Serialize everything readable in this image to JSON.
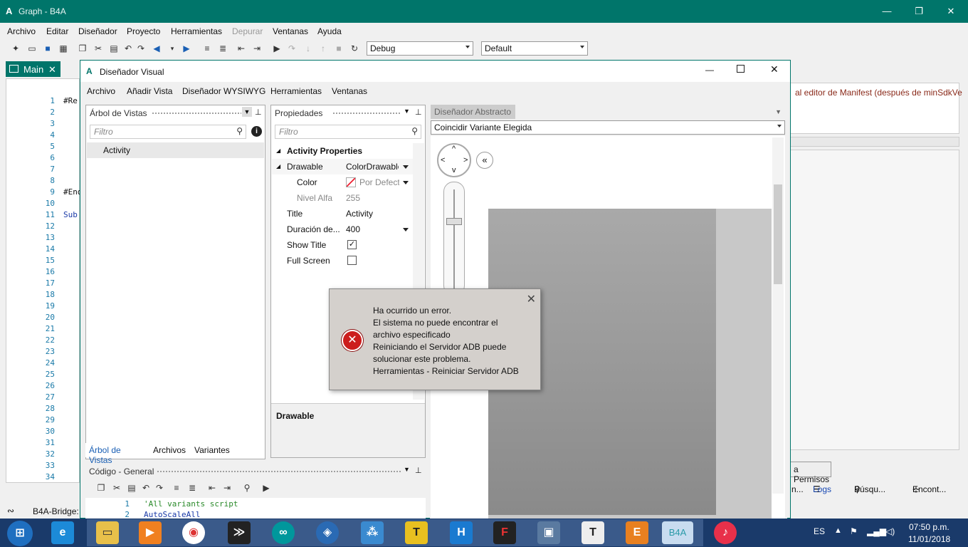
{
  "window": {
    "logo": "A",
    "title": "Graph - B4A",
    "minimize": "—",
    "restore": "❐",
    "close": "✕"
  },
  "menu": [
    "Archivo",
    "Editar",
    "Diseñador",
    "Proyecto",
    "Herramientas",
    "Depurar",
    "Ventanas",
    "Ayuda"
  ],
  "toolbar": {
    "config_combo": "Debug",
    "theme_combo": "Default"
  },
  "doc_tab": {
    "label": "Main",
    "close": "✕"
  },
  "editor": {
    "lines": [
      "1",
      "2",
      "3",
      "4",
      "5",
      "6",
      "7",
      "8",
      "9",
      "10",
      "11",
      "12",
      "13",
      "14",
      "15",
      "16",
      "17",
      "18",
      "19",
      "20",
      "21",
      "22",
      "23",
      "24",
      "25",
      "26",
      "27",
      "28",
      "29",
      "30",
      "31",
      "32",
      "33",
      "34"
    ],
    "code": [
      {
        "line": 1,
        "text": "#Re"
      },
      {
        "line": 9,
        "text": "#End"
      },
      {
        "line": 11,
        "text": "Sub"
      }
    ]
  },
  "right_pane": {
    "manifest_text": "al editor de Manifest (después de minSdkVe",
    "permisos_button": "a Permisos",
    "bottom_tabs": [
      "n...",
      "Logs",
      "Búsqu...",
      "Encont..."
    ]
  },
  "status": {
    "bridge": "B4A-Bridge:"
  },
  "designer": {
    "logo": "A",
    "title": "Diseñador Visual",
    "menu": [
      "Archivo",
      "Añadir Vista",
      "Diseñador WYSIWYG",
      "Herramientas",
      "Ventanas"
    ],
    "tree_panel": {
      "header": "Árbol de Vistas",
      "filter_placeholder": "Filtro",
      "items": [
        "Activity"
      ],
      "tabs": [
        "Árbol de Vistas",
        "Archivos",
        "Variantes"
      ]
    },
    "props_panel": {
      "header": "Propiedades",
      "filter_placeholder": "Filtro",
      "section": "Activity Properties",
      "rows": [
        {
          "name": "Drawable",
          "value": "ColorDrawable"
        },
        {
          "name": "Color",
          "value": "Por Defecto"
        },
        {
          "name": "Nivel Alfa",
          "value": "255"
        },
        {
          "name": "Title",
          "value": "Activity"
        },
        {
          "name": "Duración de...",
          "value": "400"
        },
        {
          "name": "Show Title",
          "value": "✓"
        },
        {
          "name": "Full Screen",
          "value": ""
        }
      ],
      "description": "Drawable"
    },
    "abstract": {
      "tab": "Diseñador Abstracto",
      "variant": "Coincidir Variante Elegida"
    },
    "code_panel": {
      "header": "Código - General",
      "lines": [
        {
          "num": "1",
          "text": "'All variants script"
        },
        {
          "num": "2",
          "text": "AutoScaleAll"
        }
      ]
    }
  },
  "error_dialog": {
    "lines": [
      "Ha ocurrido un error.",
      "El sistema no puede encontrar el",
      "archivo especificado",
      "Reiniciando el Servidor ADB puede",
      "solucionar este problema.",
      "Herramientas - Reiniciar Servidor ADB"
    ],
    "close": "✕"
  },
  "taskbar": {
    "apps": [
      "b4a-icon",
      "music-icon"
    ],
    "b4a_label": "B4A",
    "lang": "ES",
    "time": "07:50 p.m.",
    "date": "11/01/2018"
  },
  "colors": {
    "accent": "#00756a",
    "error_red": "#cc1d1d",
    "taskbar": "#1a3a6a"
  }
}
